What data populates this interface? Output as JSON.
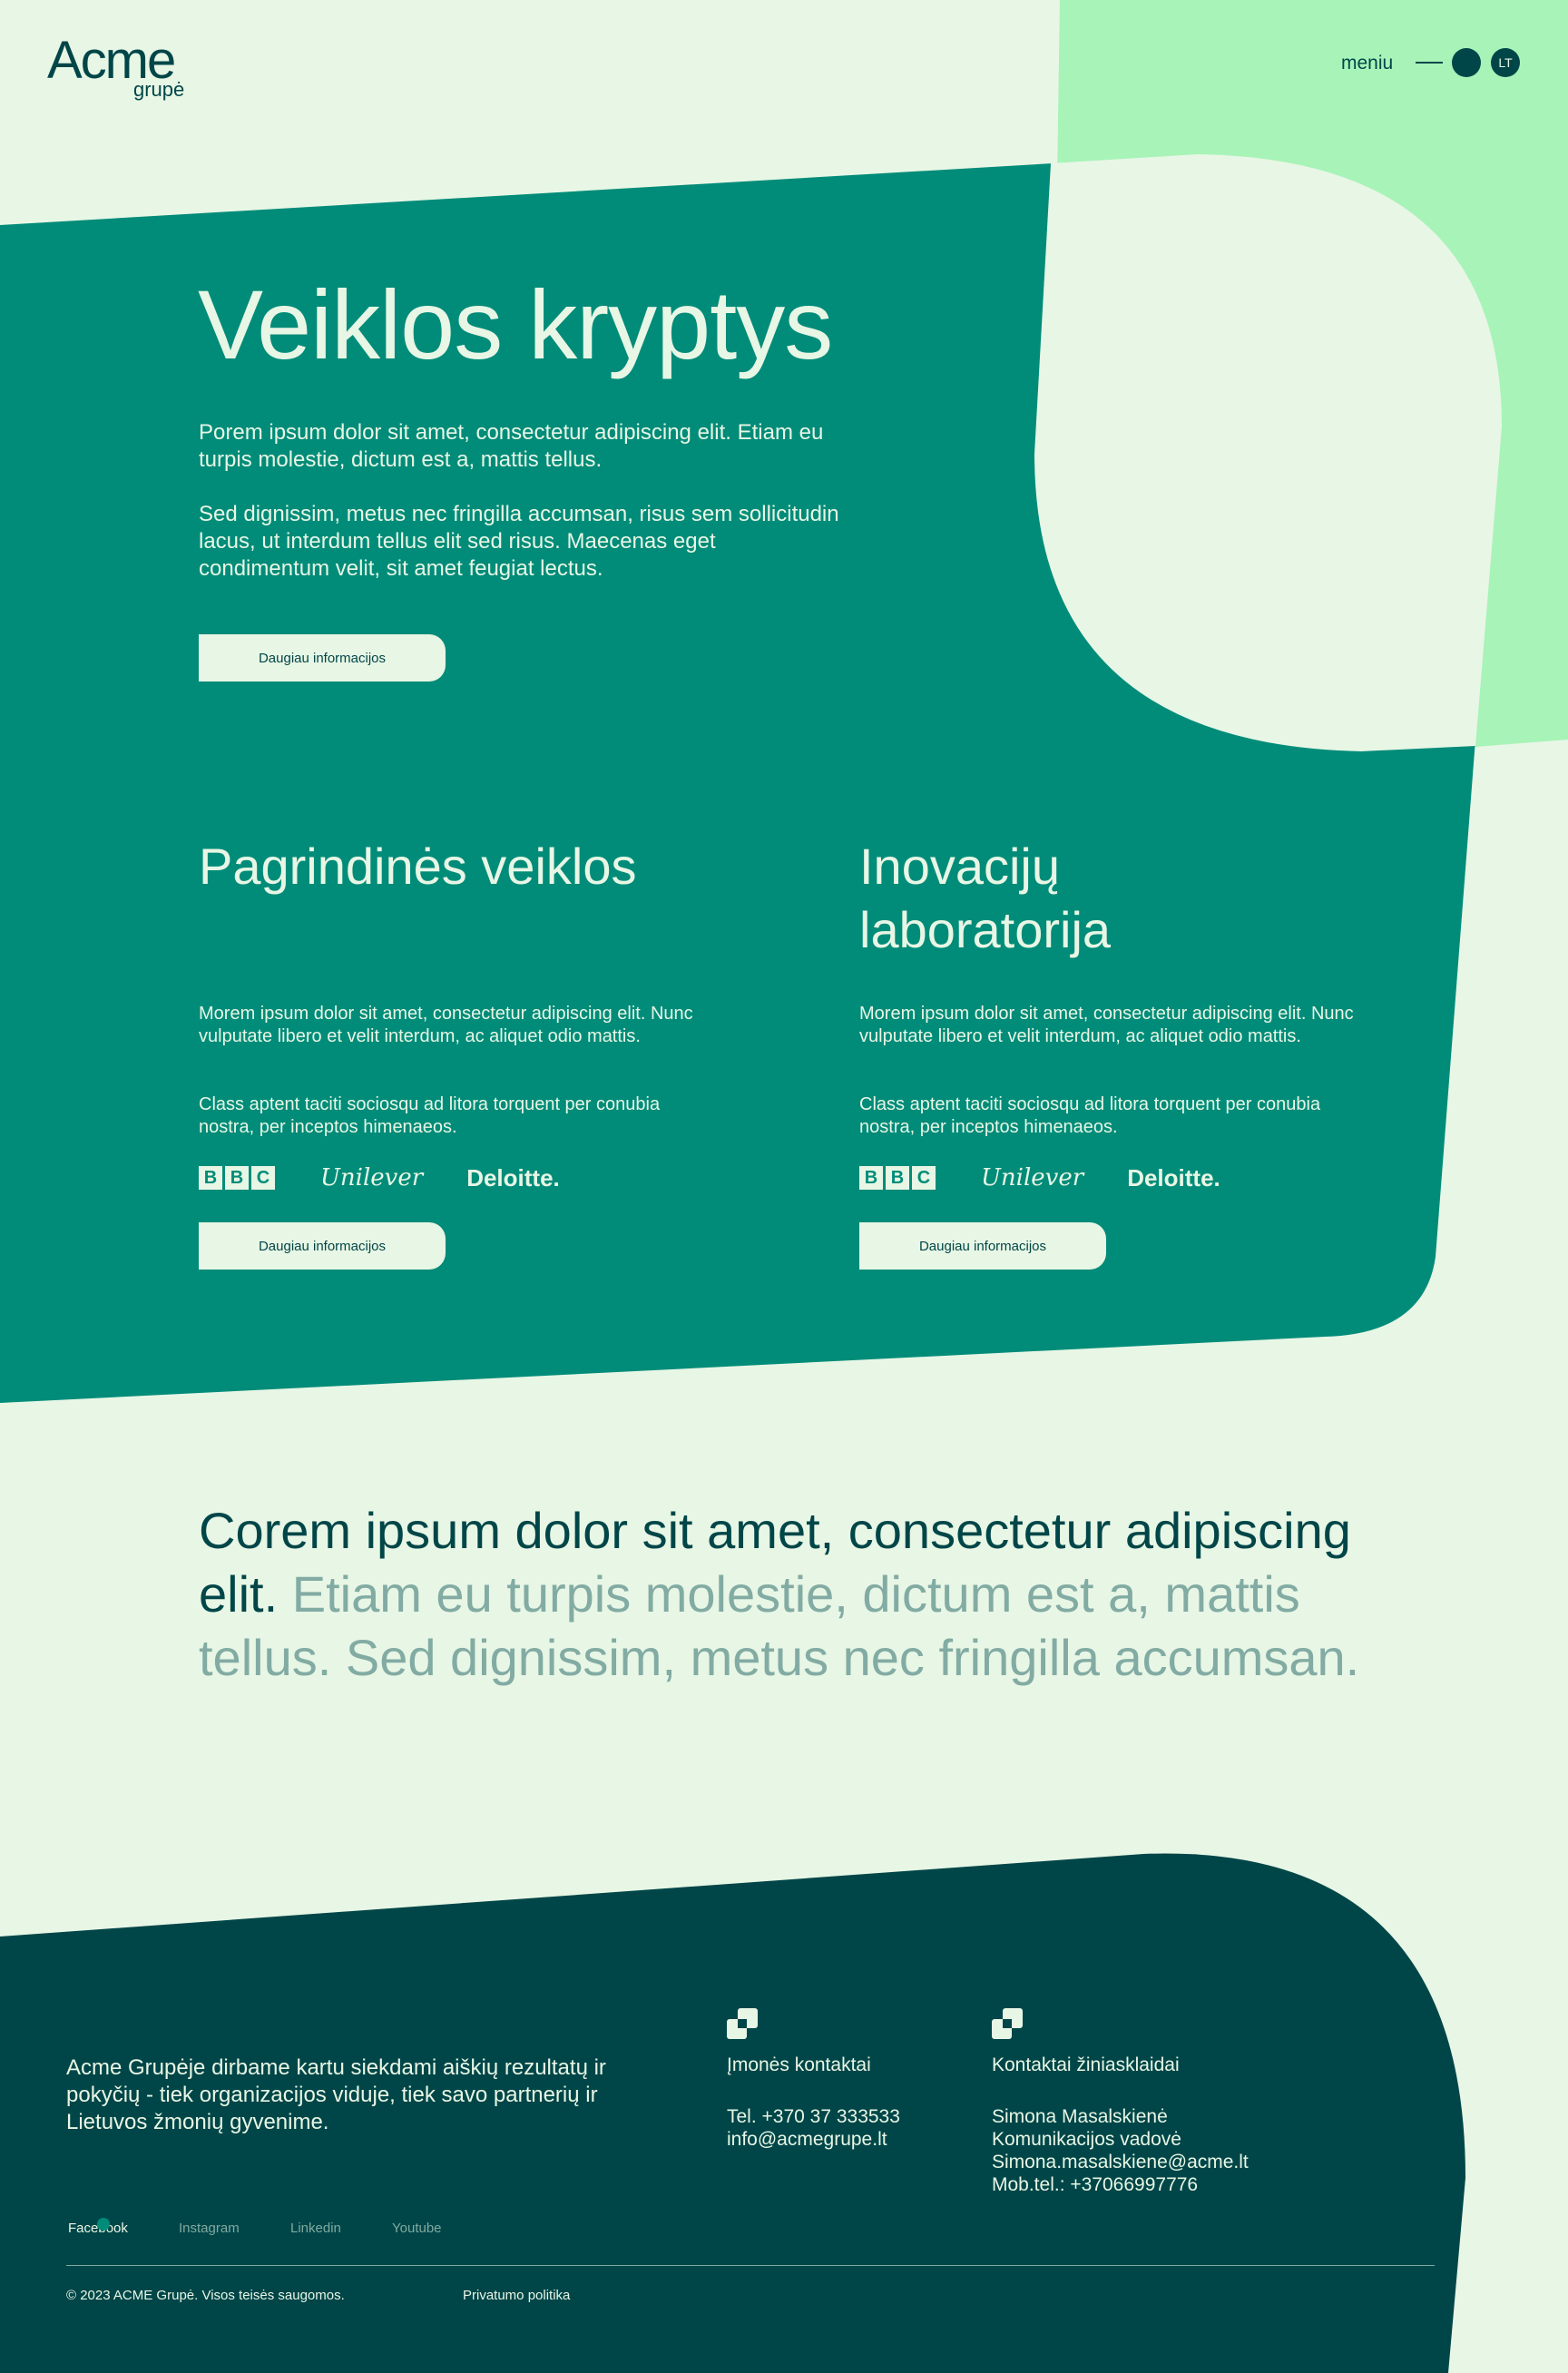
{
  "colors": {
    "page_background": "#e8f6e5",
    "teal": "#008c79",
    "mint": "#a8f3b8",
    "dark_green": "#004648",
    "muted_text": "#82aba3"
  },
  "header": {
    "logo_main": "Acme",
    "logo_sub": "grupė",
    "menu_label": "meniu",
    "language": "LT"
  },
  "hero": {
    "title": "Veiklos kryptys",
    "paragraph_1": "Porem ipsum dolor sit amet, consectetur adipiscing elit. Etiam eu turpis molestie, dictum est a, mattis tellus.",
    "paragraph_2": "Sed dignissim, metus nec fringilla accumsan, risus sem sollicitudin lacus, ut interdum tellus elit sed risus. Maecenas eget condimentum velit, sit amet feugiat lectus.",
    "button_label": "Daugiau informacijos"
  },
  "columns": [
    {
      "title": "Pagrindinės veiklos",
      "paragraph_1": "Morem ipsum dolor sit amet, consectetur adipiscing elit. Nunc vulputate libero et velit interdum, ac aliquet odio mattis.",
      "paragraph_2": "Class aptent taciti sociosqu ad litora torquent per conubia nostra, per inceptos himenaeos.",
      "button_label": "Daugiau informacijos"
    },
    {
      "title": "Inovacijų laboratorija",
      "paragraph_1": "Morem ipsum dolor sit amet, consectetur adipiscing elit. Nunc vulputate libero et velit interdum, ac aliquet odio mattis.",
      "paragraph_2": "Class aptent taciti sociosqu ad litora torquent per conubia nostra, per inceptos himenaeos.",
      "button_label": "Daugiau informacijos"
    }
  ],
  "brands": {
    "bbc": [
      "B",
      "B",
      "C"
    ],
    "unilever": "Unilever",
    "deloitte": "Deloitte."
  },
  "statement": {
    "highlight": "Corem ipsum dolor sit amet, consectetur adipiscing elit.",
    "muted": "Etiam eu turpis molestie, dictum est a, mattis tellus. Sed dignissim, metus nec fringilla accumsan."
  },
  "footer": {
    "about": "Acme Grupėje dirbame kartu siekdami aiškių rezultatų ir pokyčių - tiek organizacijos viduje, tiek savo partnerių ir Lietuvos žmonių gyvenime.",
    "company_contacts": {
      "heading": "Įmonės kontaktai",
      "phone": "Tel. +370 37 333533",
      "email": "info@acmegrupe.lt"
    },
    "media_contacts": {
      "heading": "Kontaktai žiniasklaidai",
      "name": "Simona Masalskienė",
      "role": "Komunikacijos vadovė",
      "email": "Simona.masalskiene@acme.lt",
      "mobile": "Mob.tel.: +37066997776"
    },
    "social": [
      "Facebook",
      "Instagram",
      "Linkedin",
      "Youtube"
    ],
    "copyright": "© 2023 ACME Grupė. Visos teisės saugomos.",
    "privacy": "Privatumo politika"
  }
}
